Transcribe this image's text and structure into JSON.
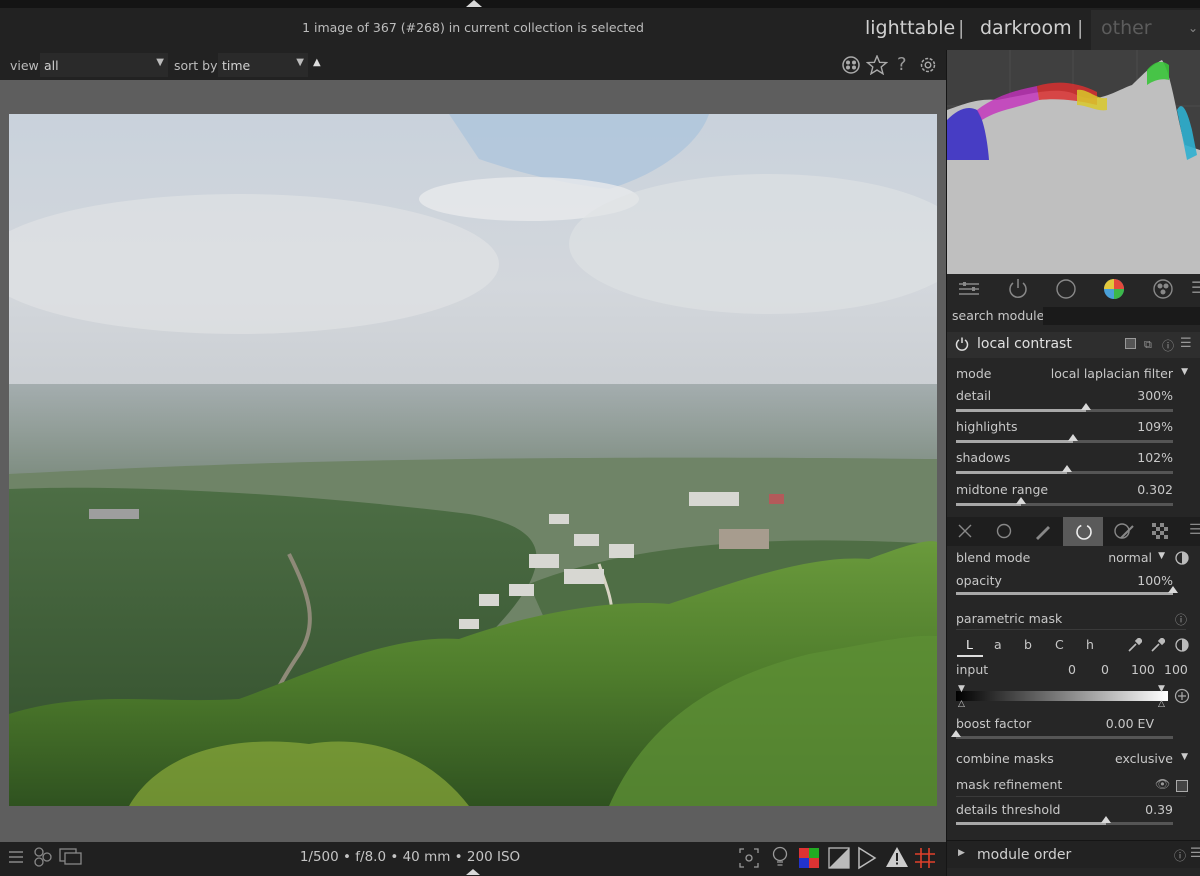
{
  "header": {
    "status": "1 image of 367 (#268) in current collection is selected",
    "views": {
      "lighttable": "lighttable",
      "darkroom": "darkroom",
      "other": "other",
      "separator": "|"
    }
  },
  "filter_bar": {
    "view_label": "view",
    "view_value": "all",
    "sort_label": "sort by",
    "sort_value": "time"
  },
  "image_info": {
    "exif": "1/500 • f/8.0 • 40 mm • 200 ISO"
  },
  "right_panel": {
    "search_label": "search module",
    "module": {
      "title": "local contrast",
      "mode_label": "mode",
      "mode_value": "local laplacian filter",
      "sliders": [
        {
          "label": "detail",
          "value_text": "300%",
          "position": 0.6
        },
        {
          "label": "highlights",
          "value_text": "109%",
          "position": 0.54
        },
        {
          "label": "shadows",
          "value_text": "102%",
          "position": 0.51
        },
        {
          "label": "midtone range",
          "value_text": "0.302",
          "position": 0.3
        }
      ]
    },
    "blending": {
      "blend_mode_label": "blend mode",
      "blend_mode_value": "normal",
      "opacity_label": "opacity",
      "opacity_value": "100%",
      "opacity_position": 1.0,
      "mask_header": "parametric mask",
      "channels": [
        "L",
        "a",
        "b",
        "C",
        "h"
      ],
      "input_label": "input",
      "input_values": [
        "0",
        "0",
        "100",
        "100"
      ],
      "boost_label": "boost factor",
      "boost_value": "0.00 EV",
      "boost_position": 0.0,
      "combine_label": "combine masks",
      "combine_value": "exclusive",
      "refinement_label": "mask refinement",
      "details_label": "details threshold",
      "details_value": "0.39",
      "details_position": 0.69
    },
    "module_order": "module order"
  },
  "colors": {
    "panel_bg": "#262626",
    "center_bg": "#5e5e5e",
    "histogram_bg": "#404040",
    "active_tab_bg": "#5a5a5a"
  }
}
